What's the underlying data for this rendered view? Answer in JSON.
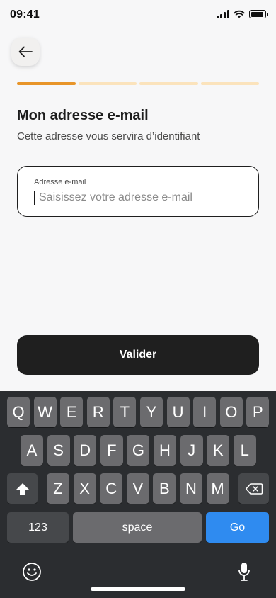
{
  "status_bar": {
    "time": "09:41"
  },
  "progress": {
    "total_steps": 4,
    "current_step": 1
  },
  "page": {
    "title": "Mon adresse e-mail",
    "subtitle": "Cette adresse vous servira d’identifiant"
  },
  "email_field": {
    "label": "Adresse e-mail",
    "placeholder": "Saisissez votre adresse e-mail",
    "value": ""
  },
  "submit_button": {
    "label": "Valider"
  },
  "keyboard": {
    "row1": [
      "Q",
      "W",
      "E",
      "R",
      "T",
      "Y",
      "U",
      "I",
      "O",
      "P"
    ],
    "row2": [
      "A",
      "S",
      "D",
      "F",
      "G",
      "H",
      "J",
      "K",
      "L"
    ],
    "row3": [
      "Z",
      "X",
      "C",
      "V",
      "B",
      "N",
      "M"
    ],
    "numbers_label": "123",
    "space_label": "space",
    "go_label": "Go"
  },
  "colors": {
    "accent": "#e8952a",
    "progress_inactive": "#fbe3bc",
    "button_dark": "#1f1f1f",
    "go_key": "#2f8bf0"
  },
  "icons": {
    "back": "arrow-left-icon",
    "shift": "shift-icon",
    "delete": "backspace-icon",
    "emoji": "emoji-icon",
    "microphone": "microphone-icon"
  }
}
